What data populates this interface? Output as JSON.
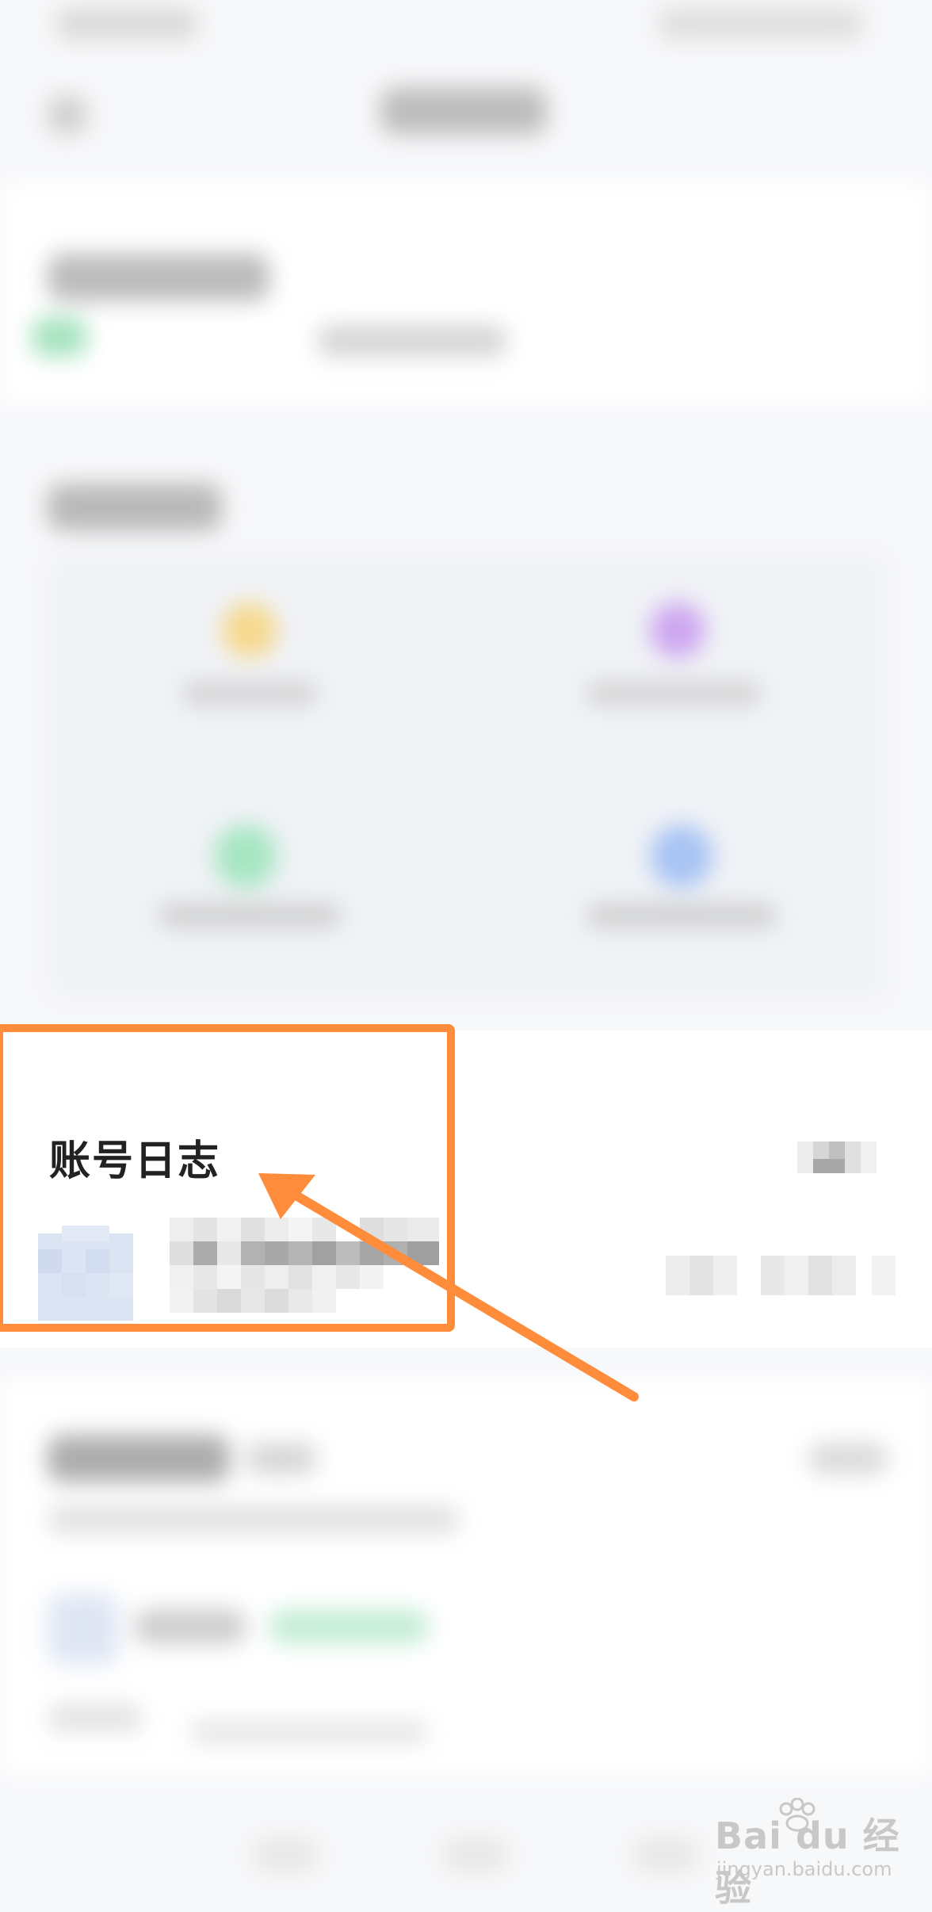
{
  "account_log": {
    "title": "账号日志"
  },
  "watermark": {
    "brand": "Bai du 经验",
    "site": "jingyan.baidu.com"
  },
  "colors": {
    "highlight": "#ff8c3a",
    "background": "#f7f8fa",
    "card": "#ffffff",
    "title_text": "#222222"
  },
  "icons": [
    "avatar-icon",
    "arrow-annotation-icon",
    "baidu-paw-logo-icon"
  ]
}
